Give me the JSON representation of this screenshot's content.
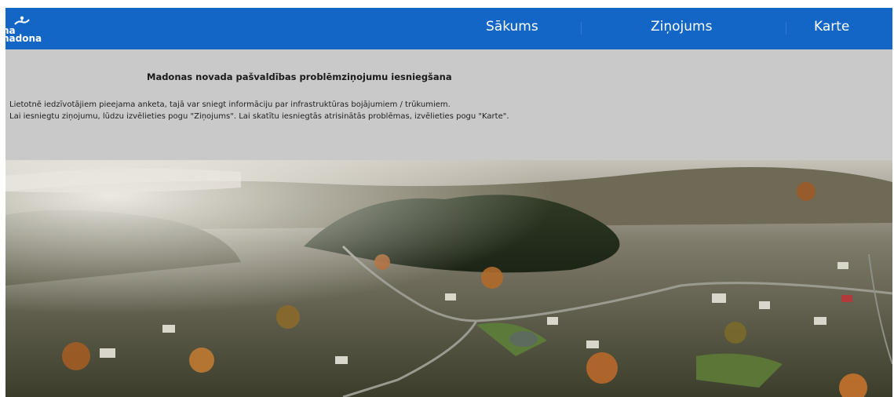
{
  "header": {
    "logo": {
      "line1": "na",
      "line2": "nadona",
      "icon": "madona-crest-icon"
    },
    "nav": [
      {
        "label": "Sākums"
      },
      {
        "label": "Ziņojums"
      },
      {
        "label": "Karte"
      }
    ],
    "colors": {
      "bar": "#1366c6",
      "text": "#ffffff"
    }
  },
  "intro": {
    "title": "Madonas novada pašvaldības problēmziņojumu iesniegšana",
    "paragraph1": "Lietotnē iedzīvotājiem pieejama anketa, tajā var sniegt informāciju par infrastruktūras bojājumiem / trūkumiem.",
    "paragraph2": "Lai iesniegtu ziņojumu, lūdzu izvēlieties pogu \"Ziņojums\". Lai skatītu iesniegtās atrisinātās problēmas, izvēlieties pogu \"Karte\".",
    "background": "#c9c9c9"
  },
  "hero": {
    "image": "aerial-town-photo"
  }
}
